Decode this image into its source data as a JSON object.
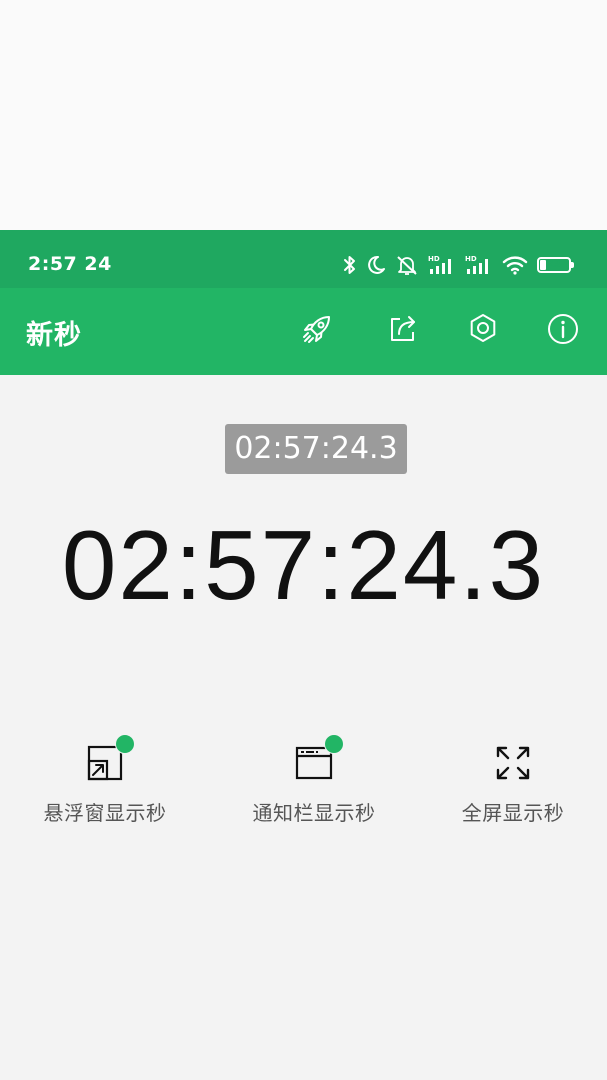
{
  "status_bar": {
    "time": "2:57",
    "seconds": "24",
    "battery_level": "23",
    "battery_fraction": 0.23,
    "icons": [
      "bluetooth-icon",
      "moon-icon",
      "bell-off-icon",
      "hd-signal-icon",
      "hd-signal-icon",
      "wifi-icon",
      "battery-icon"
    ]
  },
  "app_bar": {
    "title": "新秒",
    "actions": [
      "rocket-icon",
      "share-icon",
      "settings-icon",
      "info-icon"
    ]
  },
  "clock": {
    "small_time": "02:57:24.3",
    "large_time": "02:57:24.3"
  },
  "actions": [
    {
      "label": "悬浮窗显示秒",
      "icon": "floating-window-icon",
      "badge": true
    },
    {
      "label": "通知栏显示秒",
      "icon": "notification-window-icon",
      "badge": true
    },
    {
      "label": "全屏显示秒",
      "icon": "fullscreen-icon",
      "badge": false
    }
  ],
  "colors": {
    "status_bar": "#1fa860",
    "app_bar": "#22b565",
    "badge": "#22b565",
    "time_chip": "#9b9b9b",
    "background": "#f3f3f3"
  }
}
